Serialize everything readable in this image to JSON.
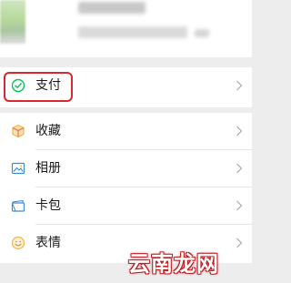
{
  "menu": {
    "pay": {
      "label": "支付",
      "icon": "wechat-pay-icon"
    },
    "items": [
      {
        "label": "收藏",
        "icon": "favorites-cube-icon"
      },
      {
        "label": "相册",
        "icon": "album-icon"
      },
      {
        "label": "卡包",
        "icon": "card-wallet-icon"
      },
      {
        "label": "表情",
        "icon": "emoji-smiley-icon"
      }
    ]
  },
  "watermark": "云南龙网",
  "colors": {
    "highlight": "#d9272e",
    "pay_green": "#07c160",
    "favorites": "#f2b54a",
    "album": "#3f8ad6",
    "cards": "#3f8ad6",
    "emoji": "#f2b54a"
  }
}
